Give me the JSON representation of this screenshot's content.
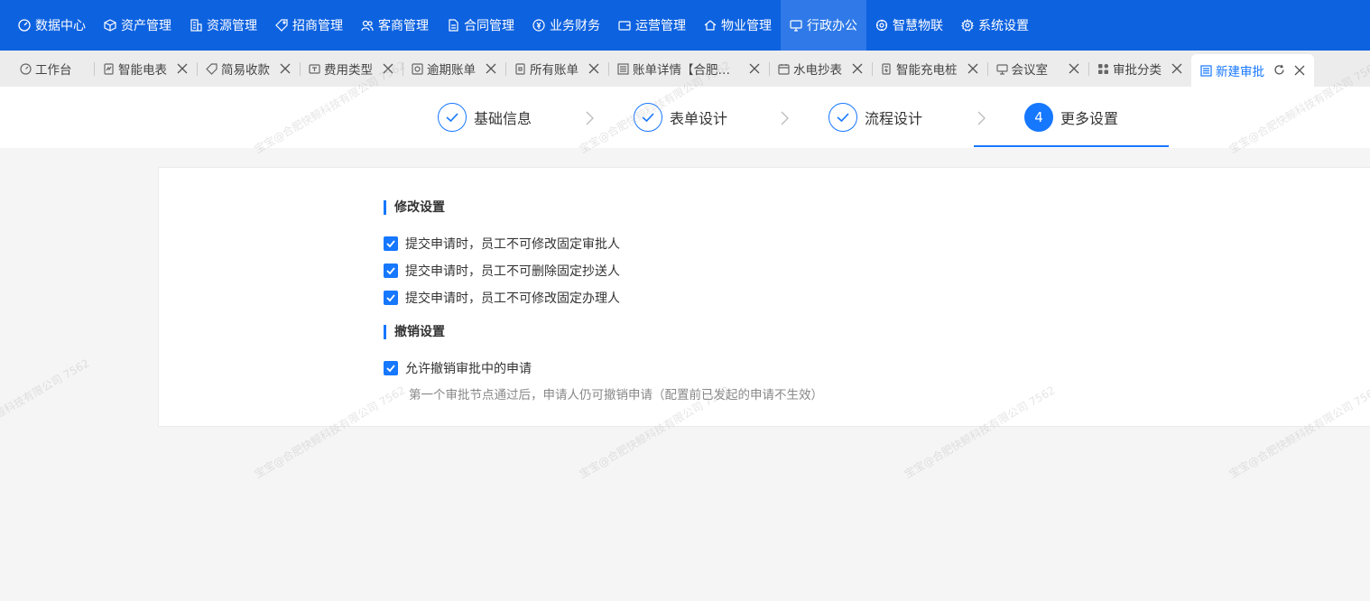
{
  "topnav": {
    "items": [
      {
        "label": "数据中心",
        "icon": "dashboard-icon"
      },
      {
        "label": "资产管理",
        "icon": "cube-icon"
      },
      {
        "label": "资源管理",
        "icon": "building-icon"
      },
      {
        "label": "招商管理",
        "icon": "tag-icon"
      },
      {
        "label": "客商管理",
        "icon": "users-icon"
      },
      {
        "label": "合同管理",
        "icon": "document-icon"
      },
      {
        "label": "业务财务",
        "icon": "yen-icon"
      },
      {
        "label": "运营管理",
        "icon": "wallet-icon"
      },
      {
        "label": "物业管理",
        "icon": "home-icon"
      },
      {
        "label": "行政办公",
        "icon": "monitor-icon",
        "active": true
      },
      {
        "label": "智慧物联",
        "icon": "iot-icon"
      },
      {
        "label": "系统设置",
        "icon": "gear-icon"
      }
    ]
  },
  "tabs": [
    {
      "label": "工作台",
      "icon": "dashboard-icon"
    },
    {
      "label": "智能电表",
      "icon": "meter-icon"
    },
    {
      "label": "简易收款",
      "icon": "tag-icon"
    },
    {
      "label": "费用类型",
      "icon": "folder-icon"
    },
    {
      "label": "逾期账单",
      "icon": "bill-icon"
    },
    {
      "label": "所有账单",
      "icon": "bill-icon"
    },
    {
      "label": "账单详情【合肥彼…",
      "icon": "list-icon"
    },
    {
      "label": "水电抄表",
      "icon": "calendar-icon"
    },
    {
      "label": "智能充电桩",
      "icon": "charger-icon"
    },
    {
      "label": "会议室",
      "icon": "monitor-icon"
    },
    {
      "label": "审批分类",
      "icon": "grid-icon"
    },
    {
      "label": "新建审批",
      "icon": "list-icon",
      "active": true
    }
  ],
  "stepper": {
    "steps": [
      {
        "label": "基础信息",
        "status": "done"
      },
      {
        "label": "表单设计",
        "status": "done"
      },
      {
        "label": "流程设计",
        "status": "done"
      },
      {
        "label": "更多设置",
        "status": "current",
        "number": "4"
      }
    ]
  },
  "settings": {
    "modify_title": "修改设置",
    "modify_options": [
      {
        "label": "提交申请时，员工不可修改固定审批人",
        "checked": true
      },
      {
        "label": "提交申请时，员工不可删除固定抄送人",
        "checked": true
      },
      {
        "label": "提交申请时，员工不可修改固定办理人",
        "checked": true
      }
    ],
    "revoke_title": "撤销设置",
    "revoke_option": {
      "label": "允许撤销审批中的申请",
      "checked": true
    },
    "revoke_hint": "第一个审批节点通过后，申请人仍可撤销申请（配置前已发起的申请不生效）"
  },
  "watermark": "宝宝@合肥快鲸科技有限公司 7562",
  "colors": {
    "nav_bg": "#0d62e0",
    "accent": "#1677ff",
    "page_bg": "#f5f5f5"
  }
}
